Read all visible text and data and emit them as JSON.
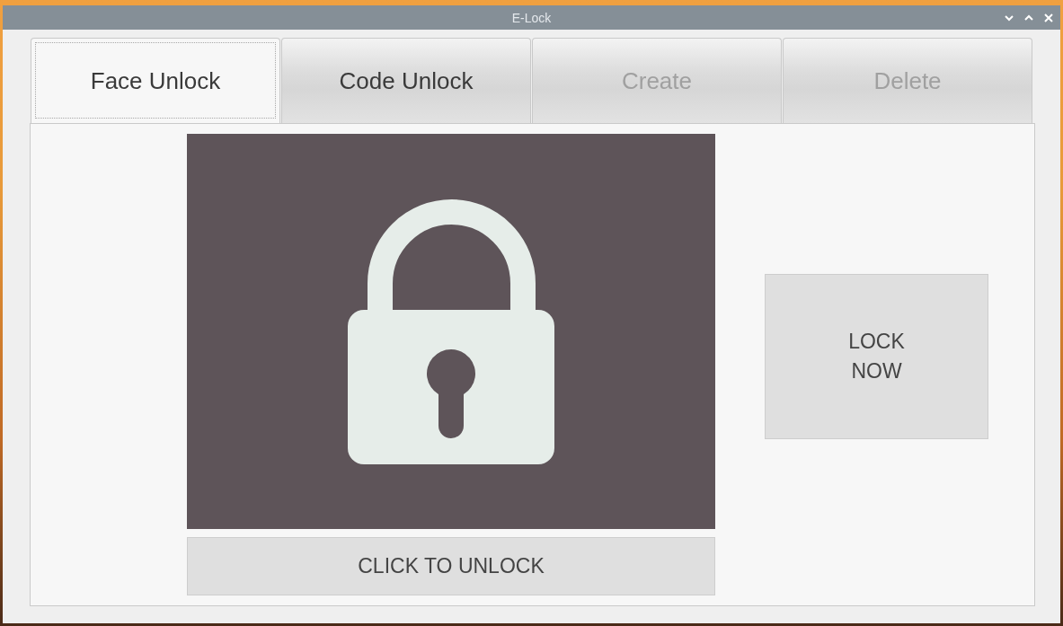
{
  "window": {
    "title": "E-Lock"
  },
  "tabs": [
    {
      "label": "Face Unlock",
      "selected": true,
      "disabled": false
    },
    {
      "label": "Code Unlock",
      "selected": false,
      "disabled": false
    },
    {
      "label": "Create",
      "selected": false,
      "disabled": true
    },
    {
      "label": "Delete",
      "selected": false,
      "disabled": true
    }
  ],
  "unlock_button": {
    "label": "CLICK TO UNLOCK"
  },
  "lock_button": {
    "label": "LOCK\nNOW"
  }
}
